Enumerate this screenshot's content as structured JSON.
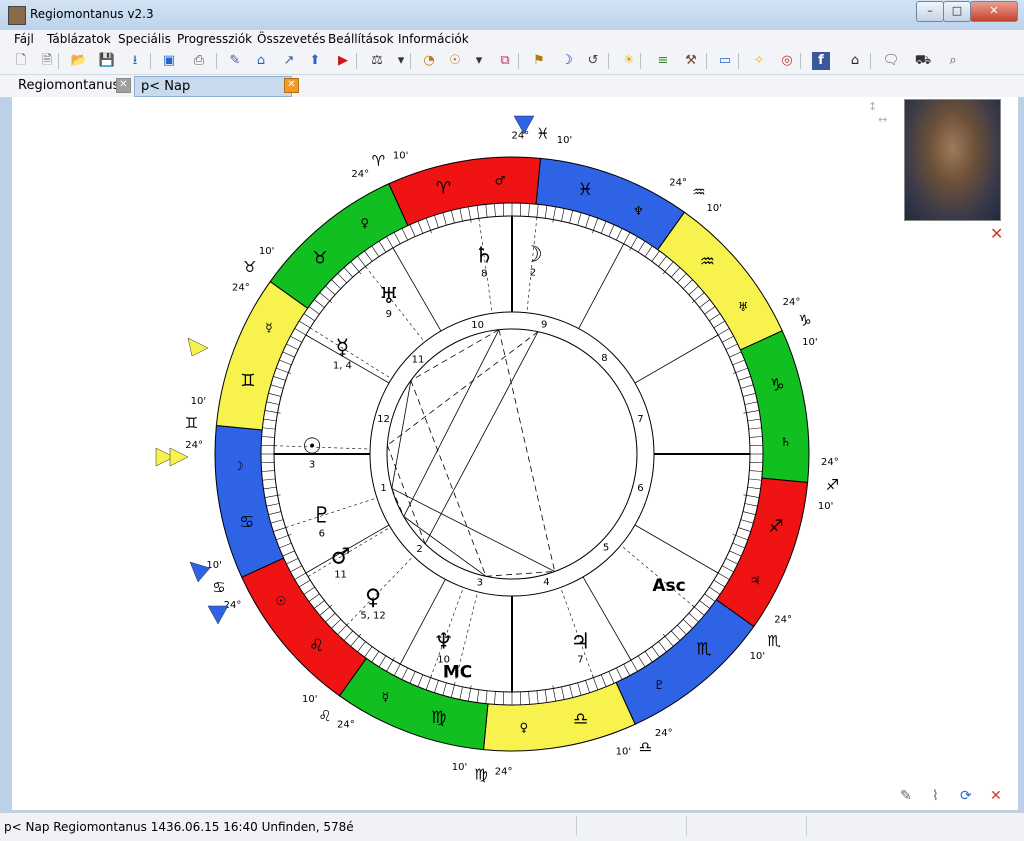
{
  "window": {
    "title": "Regiomontanus v2.3",
    "minimize": "–",
    "maximize": "□",
    "close": "✕"
  },
  "menu": [
    "Fájl",
    "Táblázatok",
    "Speciális",
    "Progressziók",
    "Összevetés",
    "Beállítások",
    "Információk"
  ],
  "tabs": [
    {
      "label": "Regiomontanus",
      "active": false
    },
    {
      "label": "p< Nap Regiomontanus",
      "active": true
    }
  ],
  "toolbar": [
    {
      "icon": "new-file-icon",
      "glyph": "🗋"
    },
    {
      "icon": "document-icon",
      "glyph": "🗎"
    },
    {
      "icon": "open-folder-icon",
      "glyph": "📂"
    },
    {
      "icon": "save-icon",
      "glyph": "💾"
    },
    {
      "icon": "export-icon",
      "glyph": "⭳"
    },
    {
      "icon": "image-icon",
      "glyph": "▣"
    },
    {
      "icon": "print-icon",
      "glyph": "⎙"
    },
    {
      "icon": "edit-pen-icon",
      "glyph": "✎"
    },
    {
      "icon": "home-icon",
      "glyph": "⌂"
    },
    {
      "icon": "cursor-icon",
      "glyph": "↗"
    },
    {
      "icon": "up-arrow-icon",
      "glyph": "⬆"
    },
    {
      "icon": "play-icon",
      "glyph": "▶"
    },
    {
      "icon": "aspect-icon",
      "glyph": "⚖"
    },
    {
      "icon": "dropdown-icon",
      "glyph": "▾"
    },
    {
      "icon": "clock-icon",
      "glyph": "◔"
    },
    {
      "icon": "orbit-icon",
      "glyph": "☉"
    },
    {
      "icon": "dropdown-icon",
      "glyph": "▾"
    },
    {
      "icon": "link-icon",
      "glyph": "⧉"
    },
    {
      "icon": "signpost-icon",
      "glyph": "⚑"
    },
    {
      "icon": "moon-icon",
      "glyph": "☽"
    },
    {
      "icon": "history-icon",
      "glyph": "↺"
    },
    {
      "icon": "sun-icon",
      "glyph": "☀"
    },
    {
      "icon": "chart-icon",
      "glyph": "≡"
    },
    {
      "icon": "tools-icon",
      "glyph": "⚒"
    },
    {
      "icon": "monitor-icon",
      "glyph": "▭"
    },
    {
      "icon": "lightbulb-icon",
      "glyph": "✧"
    },
    {
      "icon": "help-icon",
      "glyph": "◎"
    },
    {
      "icon": "facebook-icon",
      "glyph": "f"
    },
    {
      "icon": "graduation-icon",
      "glyph": "⌂"
    },
    {
      "icon": "speech-bubble-icon",
      "glyph": "🗨"
    },
    {
      "icon": "car-icon",
      "glyph": "⛟"
    },
    {
      "icon": "search-icon",
      "glyph": "⌕"
    }
  ],
  "chart": {
    "signs": [
      {
        "glyph": "♓",
        "color": "#2e63e6"
      },
      {
        "glyph": "♒",
        "color": "#f7f24e"
      },
      {
        "glyph": "♑",
        "color": "#12bf21"
      },
      {
        "glyph": "♐",
        "color": "#ef1313"
      },
      {
        "glyph": "♏",
        "color": "#2e63e6"
      },
      {
        "glyph": "♎",
        "color": "#f7f24e"
      },
      {
        "glyph": "♍",
        "color": "#12bf21"
      },
      {
        "glyph": "♌",
        "color": "#ef1313"
      },
      {
        "glyph": "♋",
        "color": "#2e63e6"
      },
      {
        "glyph": "♊",
        "color": "#f7f24e"
      },
      {
        "glyph": "♉",
        "color": "#12bf21"
      },
      {
        "glyph": "♈",
        "color": "#ef1313"
      }
    ],
    "rulers": [
      "♆",
      "♅",
      "♄",
      "♃",
      "♇",
      "♀",
      "☿",
      "☉",
      "☽",
      "☿",
      "♀",
      "♂"
    ],
    "cusp_labels": [
      {
        "deg": "24°",
        "min": "10'",
        "sign": "♓"
      },
      {
        "deg": "24°",
        "min": "10'",
        "sign": "♒"
      },
      {
        "deg": "24°",
        "min": "10'",
        "sign": "♑"
      },
      {
        "deg": "24°",
        "min": "10'",
        "sign": "♐"
      },
      {
        "deg": "24°",
        "min": "10'",
        "sign": "♏"
      },
      {
        "deg": "24°",
        "min": "10'",
        "sign": "♎"
      },
      {
        "deg": "24°",
        "min": "10'",
        "sign": "♍"
      },
      {
        "deg": "24°",
        "min": "10'",
        "sign": "♌"
      },
      {
        "deg": "24°",
        "min": "10'",
        "sign": "♋"
      },
      {
        "deg": "24°",
        "min": "10'",
        "sign": "♊"
      },
      {
        "deg": "24°",
        "min": "10'",
        "sign": "♉"
      },
      {
        "deg": "24°",
        "min": "10'",
        "sign": "♈"
      }
    ],
    "houses": [
      "1",
      "2",
      "3",
      "4",
      "5",
      "6",
      "7",
      "8",
      "9",
      "10",
      "11",
      "12"
    ],
    "planets": [
      {
        "glyph": "♄",
        "label": "8"
      },
      {
        "glyph": "☽",
        "label": "2"
      },
      {
        "glyph": "♅",
        "label": "9"
      },
      {
        "glyph": "☿",
        "label": "1, 4"
      },
      {
        "glyph": "☉",
        "label": "3"
      },
      {
        "glyph": "♇",
        "label": "6"
      },
      {
        "glyph": "♂",
        "label": "11"
      },
      {
        "glyph": "♀",
        "label": "5, 12"
      },
      {
        "glyph": "♆",
        "label": "10"
      },
      {
        "glyph": "MC",
        "label": ""
      },
      {
        "glyph": "♃",
        "label": "7"
      },
      {
        "glyph": "Asc",
        "label": ""
      }
    ]
  },
  "status": {
    "text": "p< Nap Regiomontanus 1436.06.15 16:40 Unfinden,     578é"
  }
}
